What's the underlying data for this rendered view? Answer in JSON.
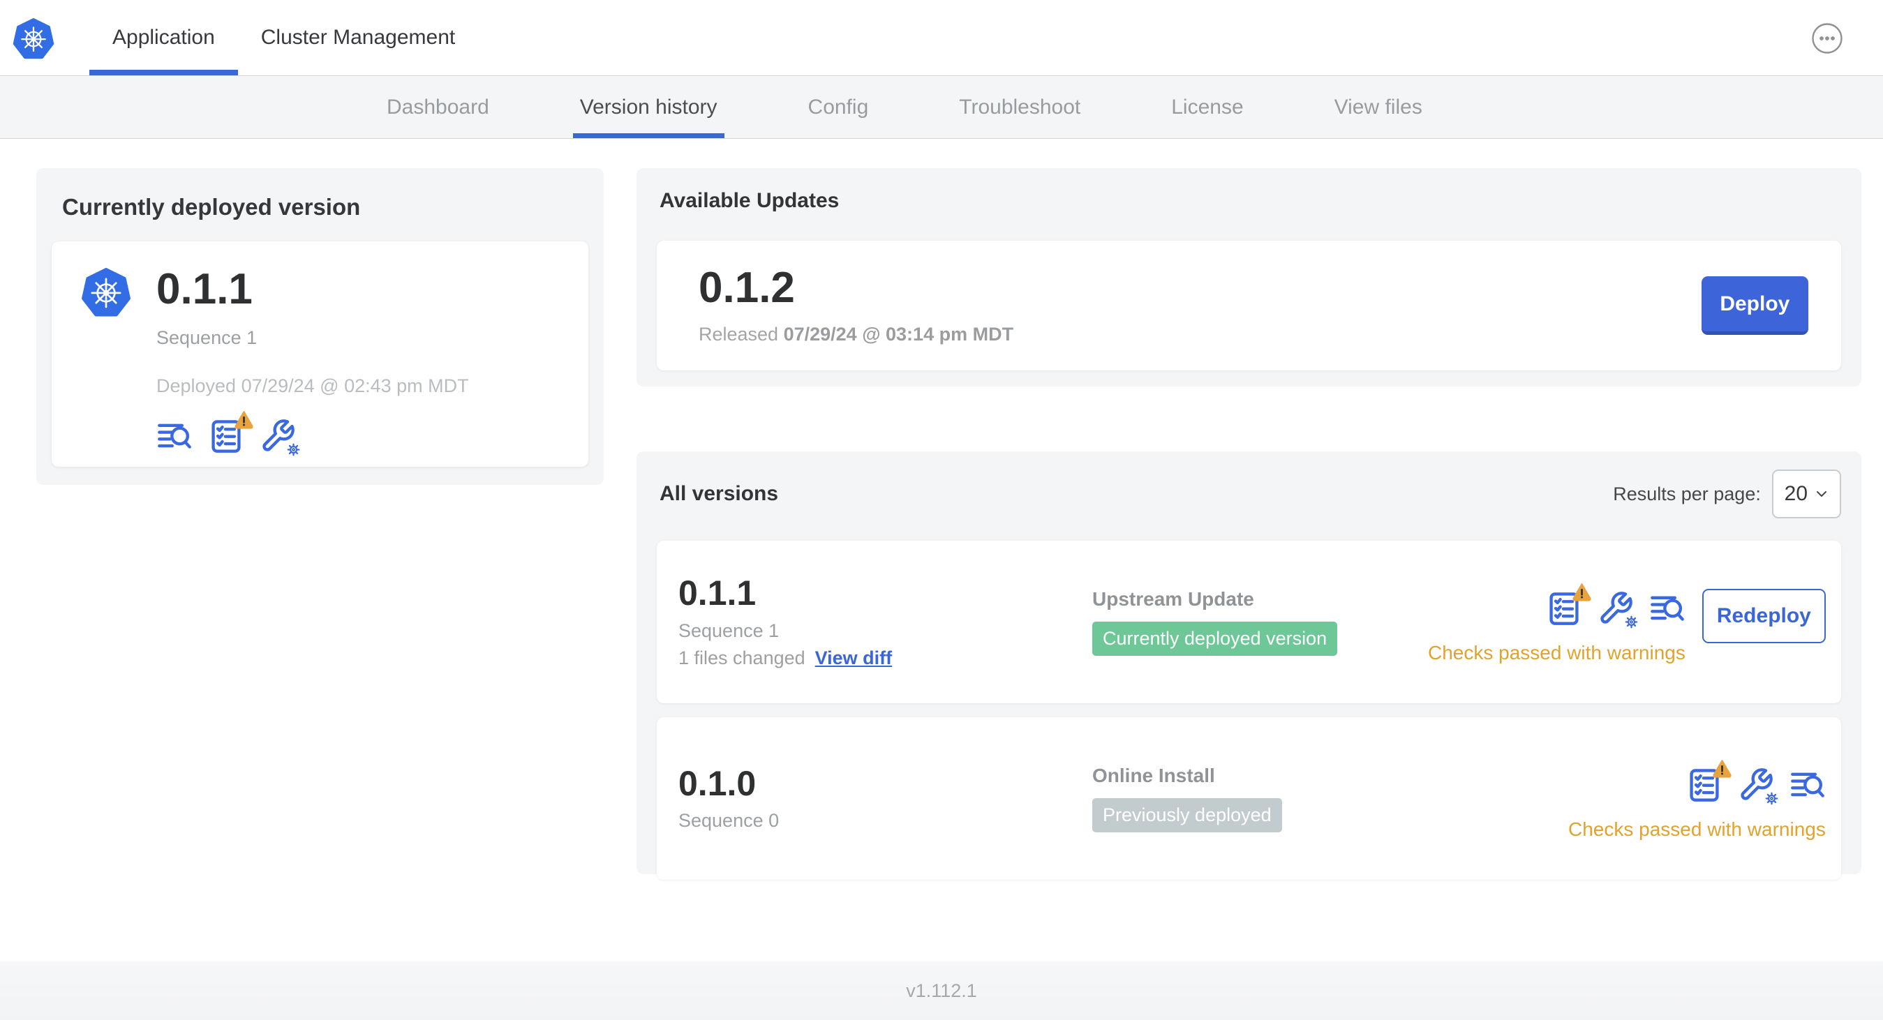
{
  "header": {
    "tabs": [
      {
        "label": "Application",
        "active": true
      },
      {
        "label": "Cluster Management",
        "active": false
      }
    ]
  },
  "subnav": {
    "items": [
      {
        "label": "Dashboard",
        "active": false
      },
      {
        "label": "Version history",
        "active": true
      },
      {
        "label": "Config",
        "active": false
      },
      {
        "label": "Troubleshoot",
        "active": false
      },
      {
        "label": "License",
        "active": false
      },
      {
        "label": "View files",
        "active": false
      }
    ]
  },
  "deployed_card": {
    "title": "Currently deployed version",
    "version": "0.1.1",
    "sequence": "Sequence 1",
    "deployed_at": "Deployed 07/29/24 @ 02:43 pm MDT"
  },
  "available_updates": {
    "title": "Available Updates",
    "update": {
      "version": "0.1.2",
      "released_prefix": "Released",
      "released_at": "07/29/24 @ 03:14 pm MDT",
      "deploy_label": "Deploy"
    }
  },
  "all_versions": {
    "title": "All versions",
    "results_per_page_label": "Results per page:",
    "results_per_page_value": "20",
    "rows": [
      {
        "version": "0.1.1",
        "sequence": "Sequence 1",
        "files_changed": "1 files changed",
        "view_diff_label": "View diff",
        "source": "Upstream Update",
        "badge": "Currently deployed version",
        "badge_color": "#6ec796",
        "status": "Checks passed with warnings",
        "action_label": "Redeploy"
      },
      {
        "version": "0.1.0",
        "sequence": "Sequence 0",
        "source": "Online Install",
        "badge": "Previously deployed",
        "badge_color": "#c2cbcd",
        "status": "Checks passed with warnings"
      }
    ]
  },
  "footer": {
    "version": "v1.112.1"
  },
  "colors": {
    "primary_blue": "#3b66d8",
    "logo_blue": "#326de6",
    "warning_orange": "#e0a32e",
    "warning_triangle": "#e8a33d",
    "badge_green": "#6ec796",
    "badge_gray": "#c2cbcd",
    "card_background": "#f4f5f7"
  },
  "icons": {
    "logo": "kubernetes-wheel-logo",
    "more_menu": "ellipsis-circle",
    "deployed_card_icons": [
      "logs-search",
      "preflight-checks-warning",
      "config-wrench-gear"
    ],
    "version_row_icons": [
      "preflight-checks-warning",
      "config-wrench-gear",
      "logs-search"
    ],
    "results_select": "chevron-down"
  }
}
